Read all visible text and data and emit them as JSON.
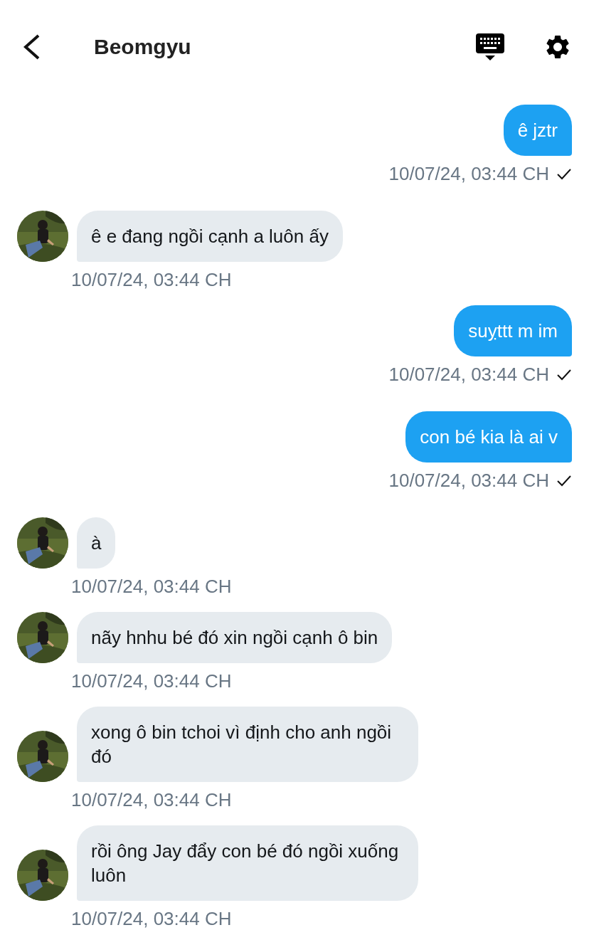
{
  "header": {
    "title": "Beomgyu"
  },
  "messages": [
    {
      "kind": "outgoing",
      "text": "ê jztr",
      "time": "10/07/24, 03:44 CH",
      "delivered": true
    },
    {
      "kind": "incoming",
      "text": "ê e đang ngồi cạnh a luôn ấy",
      "time": "10/07/24, 03:44 CH"
    },
    {
      "kind": "outgoing",
      "text": "suỵttt m im",
      "time": "10/07/24, 03:44 CH",
      "delivered": true
    },
    {
      "kind": "outgoing",
      "text": "con bé kia là ai v",
      "time": "10/07/24, 03:44 CH",
      "delivered": true
    },
    {
      "kind": "incoming",
      "text": "à",
      "time": "10/07/24, 03:44 CH"
    },
    {
      "kind": "incoming",
      "text": "nãy hnhu bé đó xin ngồi cạnh ô bin",
      "time": "10/07/24, 03:44 CH"
    },
    {
      "kind": "incoming",
      "text": "xong ô bin tchoi vì định cho anh ngồi đó",
      "time": "10/07/24, 03:44 CH"
    },
    {
      "kind": "incoming",
      "text": "rồi ông Jay đẩy con bé đó ngồi xuống luôn",
      "time": "10/07/24, 03:44 CH"
    }
  ]
}
